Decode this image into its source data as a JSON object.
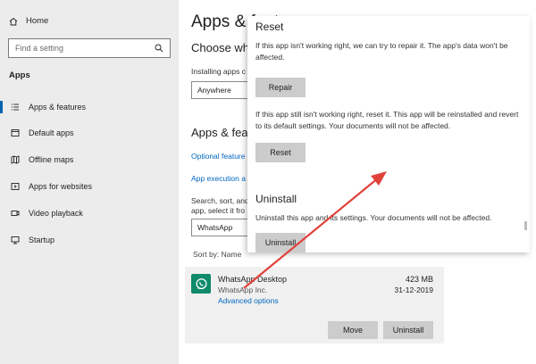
{
  "sidebar": {
    "home": "Home",
    "search_placeholder": "Find a setting",
    "section": "Apps",
    "items": [
      {
        "label": "Apps & features",
        "icon": "list-icon",
        "active": true
      },
      {
        "label": "Default apps",
        "icon": "default-apps-icon"
      },
      {
        "label": "Offline maps",
        "icon": "map-icon"
      },
      {
        "label": "Apps for websites",
        "icon": "websites-icon"
      },
      {
        "label": "Video playback",
        "icon": "video-icon"
      },
      {
        "label": "Startup",
        "icon": "startup-icon"
      }
    ]
  },
  "main": {
    "title": "Apps & features",
    "choose_heading": "Choose whe",
    "installing_text": "Installing apps c",
    "install_select": "Anywhere",
    "section2_heading": "Apps & feat",
    "optional_link": "Optional feature",
    "execution_link": "App execution a",
    "search_text_1": "Search, sort, and",
    "search_text_2": "app, select it fro",
    "filter_value": "WhatsApp",
    "sort_label": "Sort by: Name"
  },
  "app": {
    "name": "WhatsApp Desktop",
    "publisher": "WhatsApp Inc.",
    "advanced": "Advanced options",
    "size": "423 MB",
    "date": "31-12-2019",
    "move_label": "Move",
    "uninstall_label": "Uninstall"
  },
  "popup": {
    "reset_heading": "Reset",
    "repair_text": "If this app isn't working right, we can try to repair it. The app's data won't be affected.",
    "repair_button": "Repair",
    "reset_text": "If this app still isn't working right, reset it. This app will be reinstalled and revert to its default settings. Your documents will not be affected.",
    "reset_button": "Reset",
    "uninstall_heading": "Uninstall",
    "uninstall_text": "Uninstall this app and its settings. Your documents will not be affected.",
    "uninstall_button": "Uninstall"
  },
  "colors": {
    "accent": "#0063b1",
    "link": "#0067c0",
    "annotation_arrow": "#e0423a",
    "whatsapp_green": "#0f8a6b"
  }
}
